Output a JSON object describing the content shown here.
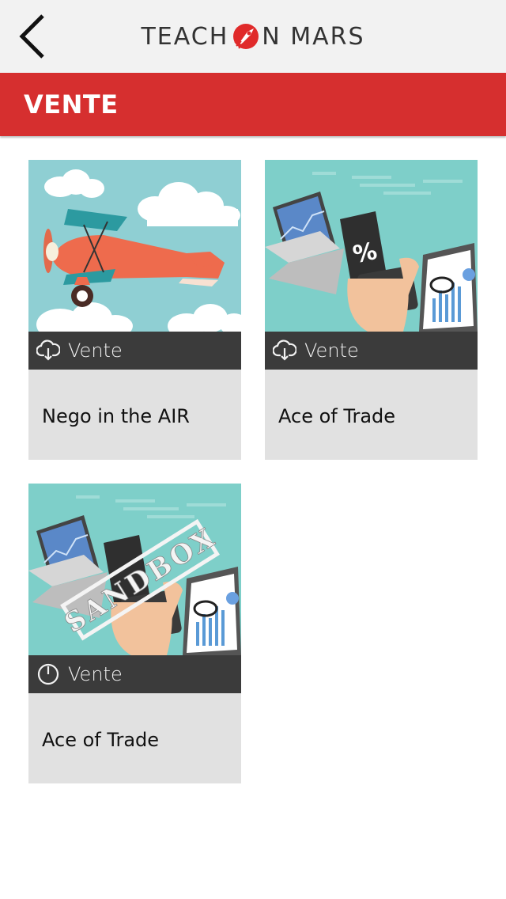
{
  "header": {
    "logo_left": "TEACH",
    "logo_right": "N MARS",
    "back_icon": "chevron-left-icon",
    "brand_color": "#d62f2f"
  },
  "section": {
    "title": "VENTE"
  },
  "cards": [
    {
      "category": "Vente",
      "category_icon": "cloud-download-icon",
      "title": "Nego in the AIR",
      "image": "airplane-illustration"
    },
    {
      "category": "Vente",
      "category_icon": "cloud-download-icon",
      "title": "Ace of Trade",
      "image": "trade-illustration"
    },
    {
      "category": "Vente",
      "category_icon": "power-icon",
      "title": "Ace of Trade",
      "image": "trade-illustration",
      "stamp": "SANDBOX"
    }
  ]
}
